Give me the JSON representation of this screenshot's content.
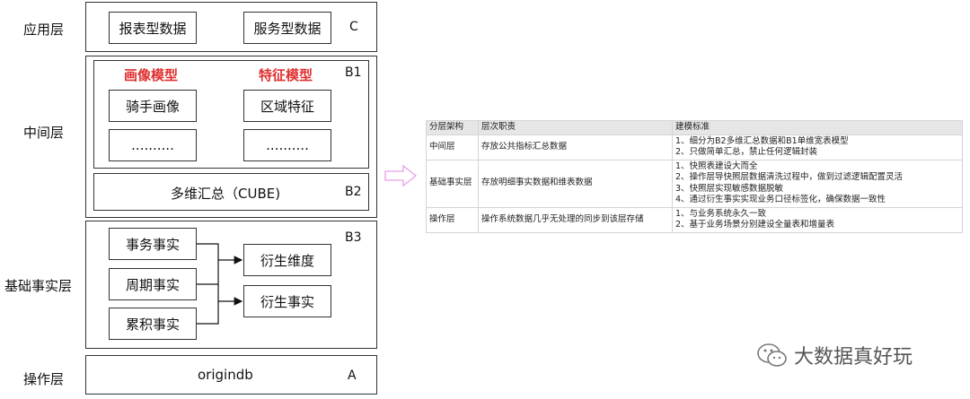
{
  "layers": {
    "app": {
      "label": "应用层",
      "tag": "C",
      "boxes": [
        "报表型数据",
        "服务型数据"
      ]
    },
    "middle": {
      "label": "中间层",
      "b1": {
        "tag": "B1",
        "portrait_title": "画像模型",
        "feature_title": "特征模型",
        "portrait_item": "骑手画像",
        "feature_item": "区域特征",
        "ellipsis": ".........."
      },
      "b2": {
        "tag": "B2",
        "text": "多维汇总（CUBE)"
      }
    },
    "base": {
      "label": "基础事实层",
      "tag": "B3",
      "facts": [
        "事务事实",
        "周期事实",
        "累积事实"
      ],
      "derived": [
        "衍生维度",
        "衍生事实"
      ]
    },
    "op": {
      "label": "操作层",
      "tag": "A",
      "text": "origindb"
    }
  },
  "table": {
    "headers": [
      "分层架构",
      "层次职责",
      "建模标准"
    ],
    "rows": [
      {
        "layer": "中间层",
        "duty": "存放公共指标汇总数据",
        "standards": [
          "1、细分为B2多维汇总数据和B1单维宽表模型",
          "2、只做简单汇总，禁止任何逻辑封装"
        ]
      },
      {
        "layer": "基础事实层",
        "duty": "存放明细事实数据和维表数据",
        "standards": [
          "1、快照表建设大而全",
          "2、操作层导快照层数据清洗过程中，做到过滤逻辑配置灵活",
          "3、快照层实现敏感数据脱敏",
          "4、通过衍生事实实现业务口径标签化，确保数据一致性"
        ]
      },
      {
        "layer": "操作层",
        "duty": "操作系统数据几乎无处理的同步到该层存储",
        "standards": [
          "1、与业务系统永久一致",
          "2、基于业务场景分别建设全量表和增量表"
        ]
      }
    ]
  },
  "watermark": {
    "icon": "wechat-icon",
    "text": "大数据真好玩"
  },
  "colors": {
    "accent_red": "#e03030",
    "arrow_pink": "#e8a0e8"
  }
}
